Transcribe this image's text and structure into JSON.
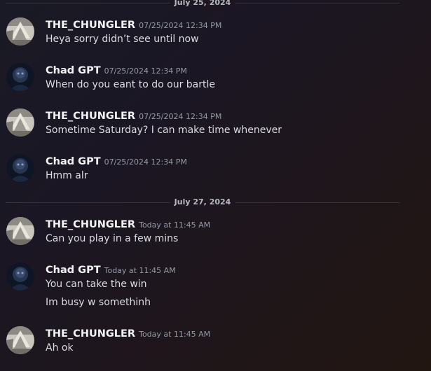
{
  "dividers": [
    "July 25, 2024",
    "July 27, 2024"
  ],
  "messages": [
    {
      "author": "THE_CHUNGLER",
      "avatar": "chungler-avatar",
      "timestamp": "07/25/2024 12:34 PM",
      "lines": [
        "Heya sorry didn’t see until now"
      ]
    },
    {
      "author": "Chad GPT",
      "avatar": "chad-avatar",
      "timestamp": "07/25/2024 12:34 PM",
      "lines": [
        "When do you eant to do our bartle"
      ]
    },
    {
      "author": "THE_CHUNGLER",
      "avatar": "chungler-avatar",
      "timestamp": "07/25/2024 12:34 PM",
      "lines": [
        "Sometime Saturday? I can make time whenever"
      ]
    },
    {
      "author": "Chad GPT",
      "avatar": "chad-avatar",
      "timestamp": "07/25/2024 12:34 PM",
      "lines": [
        "Hmm alr"
      ]
    },
    {
      "author": "THE_CHUNGLER",
      "avatar": "chungler-avatar",
      "timestamp": "Today at 11:45 AM",
      "lines": [
        "Can you play in a few mins"
      ]
    },
    {
      "author": "Chad GPT",
      "avatar": "chad-avatar",
      "timestamp": "Today at 11:45 AM",
      "lines": [
        "You can take the win",
        "Im busy w somethinh"
      ]
    },
    {
      "author": "THE_CHUNGLER",
      "avatar": "chungler-avatar",
      "timestamp": "Today at 11:45 AM",
      "lines": [
        "Ah ok"
      ]
    }
  ]
}
